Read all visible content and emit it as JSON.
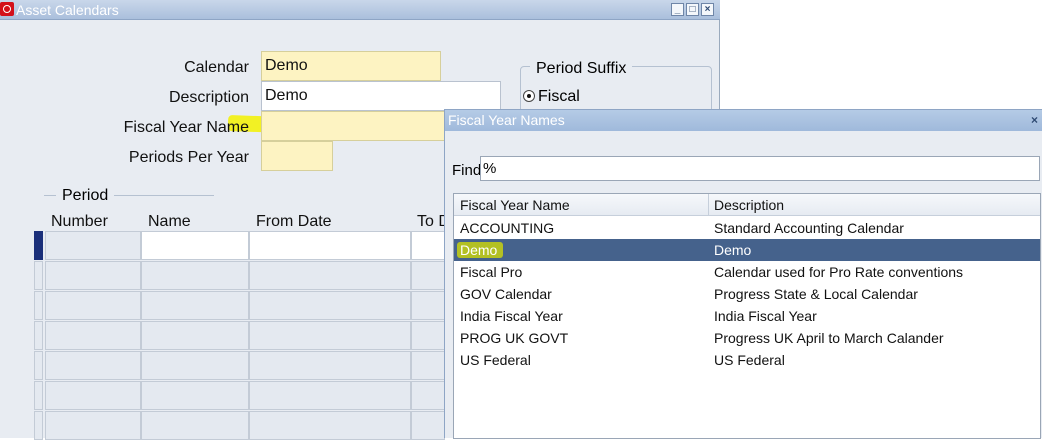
{
  "window": {
    "title": "Asset Calendars",
    "controls": {
      "minimize": "_",
      "maximize": "□",
      "close": "×"
    }
  },
  "form": {
    "calendar_label": "Calendar",
    "calendar_value": "Demo",
    "description_label": "Description",
    "description_value": "Demo",
    "fiscal_year_name_label": "Fiscal Year Name",
    "fiscal_year_name_value": "",
    "periods_per_year_label": "Periods Per Year",
    "periods_per_year_value": ""
  },
  "period_suffix": {
    "title": "Period Suffix",
    "option": "Fiscal"
  },
  "period_grid": {
    "title": "Period",
    "columns": [
      "Number",
      "Name",
      "From Date",
      "To D"
    ]
  },
  "lov": {
    "title": "Fiscal Year Names",
    "close": "×",
    "find_label": "Find",
    "find_value": "%",
    "columns": [
      "Fiscal Year Name",
      "Description"
    ],
    "rows": [
      {
        "name": "ACCOUNTING",
        "description": "Standard Accounting Calendar"
      },
      {
        "name": "Demo",
        "description": "Demo"
      },
      {
        "name": "Fiscal Pro",
        "description": "Calendar used for Pro Rate conventions"
      },
      {
        "name": "GOV Calendar",
        "description": "Progress State & Local Calendar"
      },
      {
        "name": "India Fiscal Year",
        "description": "India Fiscal Year"
      },
      {
        "name": "PROG UK GOVT",
        "description": "Progress UK April to March Calander"
      },
      {
        "name": "US Federal",
        "description": "US Federal"
      }
    ],
    "selected_index": 1
  },
  "colors": {
    "selection": "#45628c",
    "required_field": "#fdf3c2",
    "highlight": "#f3f200",
    "app_logo": "#d3101a"
  }
}
